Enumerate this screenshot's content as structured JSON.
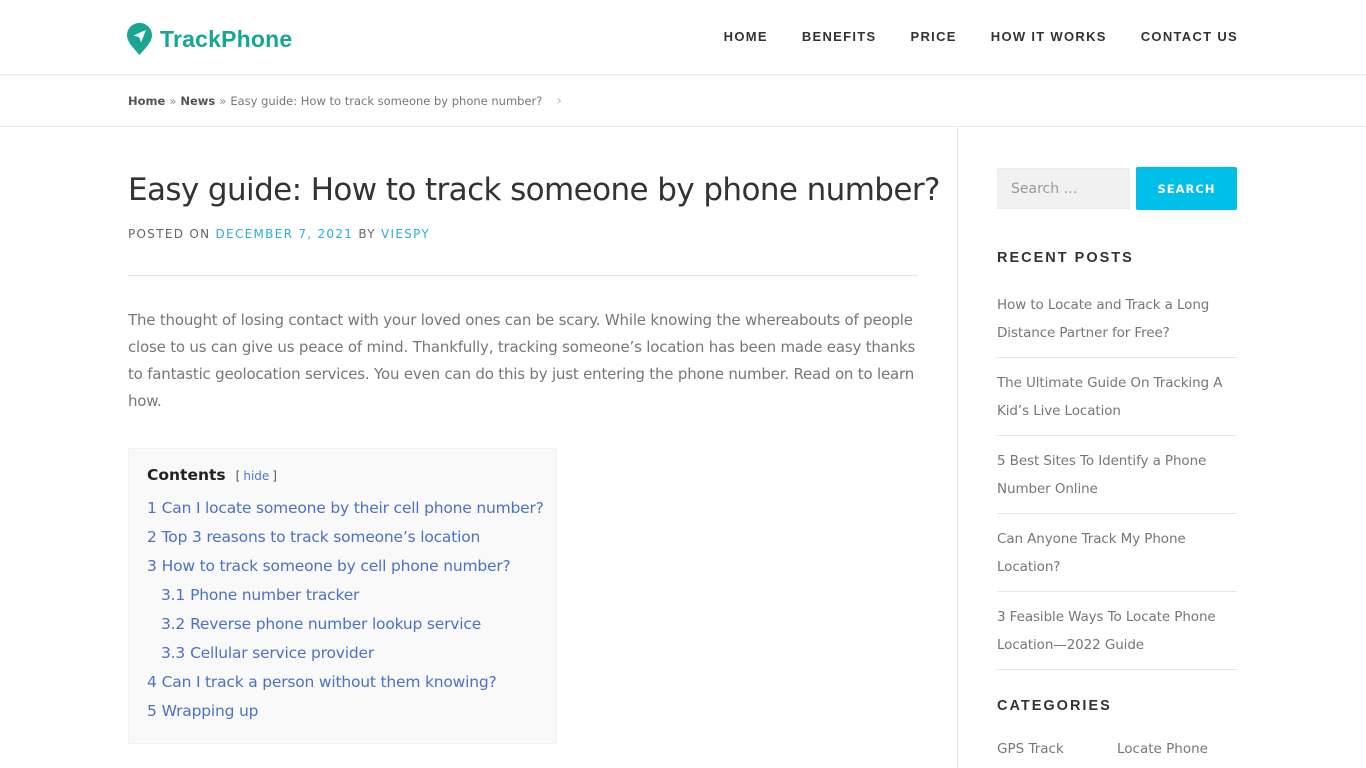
{
  "header": {
    "brand": "TrackPhone",
    "brand_color": "#17a693",
    "nav": [
      "HOME",
      "BENEFITS",
      "PRICE",
      "HOW IT WORKS",
      "CONTACT US"
    ]
  },
  "breadcrumb": {
    "items": [
      "Home",
      "News"
    ],
    "separator": "»",
    "current": "Easy guide: How to track someone by phone number?"
  },
  "post": {
    "title": "Easy guide: How to track someone by phone number?",
    "posted_on_label": "POSTED ON",
    "date": "DECEMBER 7, 2021",
    "by_label": "BY",
    "author": "VIESPY",
    "intro": "The thought of losing contact with your loved ones can be scary. While knowing the whereabouts of people close to us can give us peace of mind. Thankfully, tracking someone’s location has been made easy thanks to fantastic geolocation services. You even can do this by just entering the phone number. Read on to learn how."
  },
  "toc": {
    "title": "Contents",
    "toggle_open": "[",
    "toggle_label": "hide",
    "toggle_close": "]",
    "items": [
      {
        "num": "1",
        "label": "Can I locate someone by their cell phone number?",
        "sub": false
      },
      {
        "num": "2",
        "label": "Top 3 reasons to track someone’s location",
        "sub": false
      },
      {
        "num": "3",
        "label": "How to track someone by cell phone number?",
        "sub": false
      },
      {
        "num": "3.1",
        "label": "Phone number tracker",
        "sub": true
      },
      {
        "num": "3.2",
        "label": "Reverse phone number lookup service",
        "sub": true
      },
      {
        "num": "3.3",
        "label": "Cellular service provider",
        "sub": true
      },
      {
        "num": "4",
        "label": "Can I track a person without them knowing?",
        "sub": false
      },
      {
        "num": "5",
        "label": "Wrapping up",
        "sub": false
      }
    ]
  },
  "sidebar": {
    "search_placeholder": "Search …",
    "search_button": "SEARCH",
    "search_button_color": "#00bfe8",
    "recent_posts_title": "RECENT POSTS",
    "recent_posts": [
      "How to Locate and Track a Long Distance Partner for Free?",
      "The Ultimate Guide On Tracking A Kid’s Live Location",
      "5 Best Sites To Identify a Phone Number Online",
      "Can Anyone Track My Phone Location?",
      "3 Feasible Ways To Locate Phone Location—2022 Guide"
    ],
    "categories_title": "CATEGORIES",
    "categories": [
      "GPS Track",
      "Locate Phone"
    ]
  }
}
